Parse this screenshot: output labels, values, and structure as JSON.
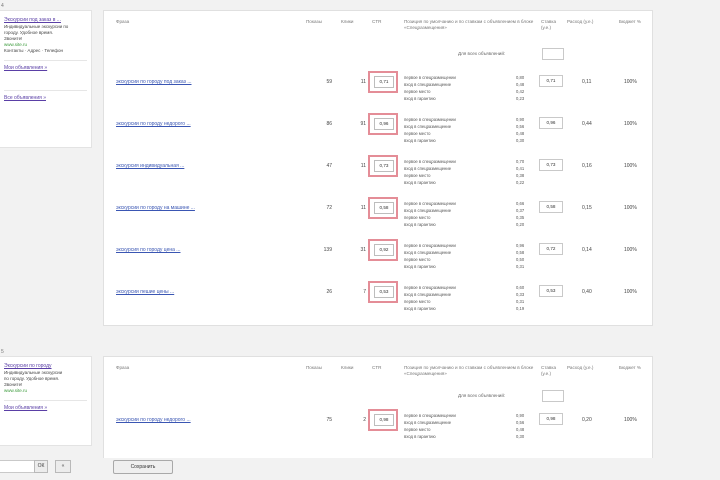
{
  "campaigns": [
    {
      "section_label": "4",
      "ad": {
        "title": "Экскурсии под заказ в ...",
        "text": [
          "Индивидуальные экскурсии по",
          "городу. Удобное время.",
          "Звоните!"
        ],
        "green_url": "www.site.ru",
        "url_line": "Контакты · Адрес · Телефон",
        "links": [
          "Мои объявления »",
          "Все объявления »"
        ]
      }
    },
    {
      "section_label": "5",
      "ad": {
        "title": "Экскурсии по городу",
        "text": [
          "Индивидуальные экскурсии",
          "по городу. Удобное время.",
          "Звоните!"
        ],
        "green_url": "www.site.ru",
        "links": [
          "Мои объявления »"
        ]
      }
    }
  ],
  "table_headers": {
    "keyword": "Фраза",
    "shows": "Показы",
    "clicks": "Клики",
    "ctr": "CTR",
    "position": "Позиция по умолчанию и по ставкам с объявлением в блоке «Спецразмещения»",
    "bid": "Ставка (у.е.)",
    "spend": "Расход (у.е.)",
    "pct": "Бюджет %"
  },
  "bulk_label": "Для всех объявлений:",
  "position_lines": [
    "первое в спецразмещении",
    "вход в спецразмещение",
    "первое место",
    "вход в гарантию"
  ],
  "rows": [
    {
      "keyword": "экскурсии по городу под заказ ...",
      "shows": "59",
      "clicks": "11",
      "bid": "0,71",
      "vals": [
        "0,80",
        "0,48",
        "0,42",
        "0,23"
      ],
      "price": "0,71",
      "spend": "0,11",
      "pct": "100%"
    },
    {
      "keyword": "экскурсии по городу недорого ...",
      "shows": "86",
      "clicks": "91",
      "bid": "0,96",
      "vals": [
        "0,90",
        "0,56",
        "0,48",
        "0,30"
      ],
      "price": "0,96",
      "spend": "0,44",
      "pct": "100%"
    },
    {
      "keyword": "экскурсия индивидуальная ...",
      "shows": "47",
      "clicks": "11",
      "bid": "0,73",
      "vals": [
        "0,70",
        "0,41",
        "0,38",
        "0,22"
      ],
      "price": "0,73",
      "spend": "0,16",
      "pct": "100%"
    },
    {
      "keyword": "экскурсии по городу на машине ...",
      "shows": "72",
      "clicks": "11",
      "bid": "0,58",
      "vals": [
        "0,66",
        "0,37",
        "0,35",
        "0,20"
      ],
      "price": "0,58",
      "spend": "0,15",
      "pct": "100%"
    },
    {
      "keyword": "экскурсия по городу цена ...",
      "shows": "139",
      "clicks": "31",
      "bid": "0,92",
      "vals": [
        "0,96",
        "0,58",
        "0,50",
        "0,31"
      ],
      "price": "0,72",
      "spend": "0,14",
      "pct": "100%"
    },
    {
      "keyword": "экскурсии пешие цены ...",
      "shows": "26",
      "clicks": "7",
      "bid": "0,53",
      "vals": [
        "0,60",
        "0,33",
        "0,31",
        "0,19"
      ],
      "price": "0,53",
      "spend": "0,40",
      "pct": "100%"
    }
  ],
  "rows2": [
    {
      "keyword": "экскурсии по городу недорого ...",
      "shows": "75",
      "clicks": "2",
      "bid": "0,98",
      "vals": [
        "0,90",
        "0,56",
        "0,48",
        "0,30"
      ],
      "price": "0,98",
      "spend": "0,20",
      "pct": "100%"
    }
  ],
  "bottom": {
    "page_btn": "ОК",
    "prev_btn": "«",
    "save_label": "Сохранить"
  }
}
